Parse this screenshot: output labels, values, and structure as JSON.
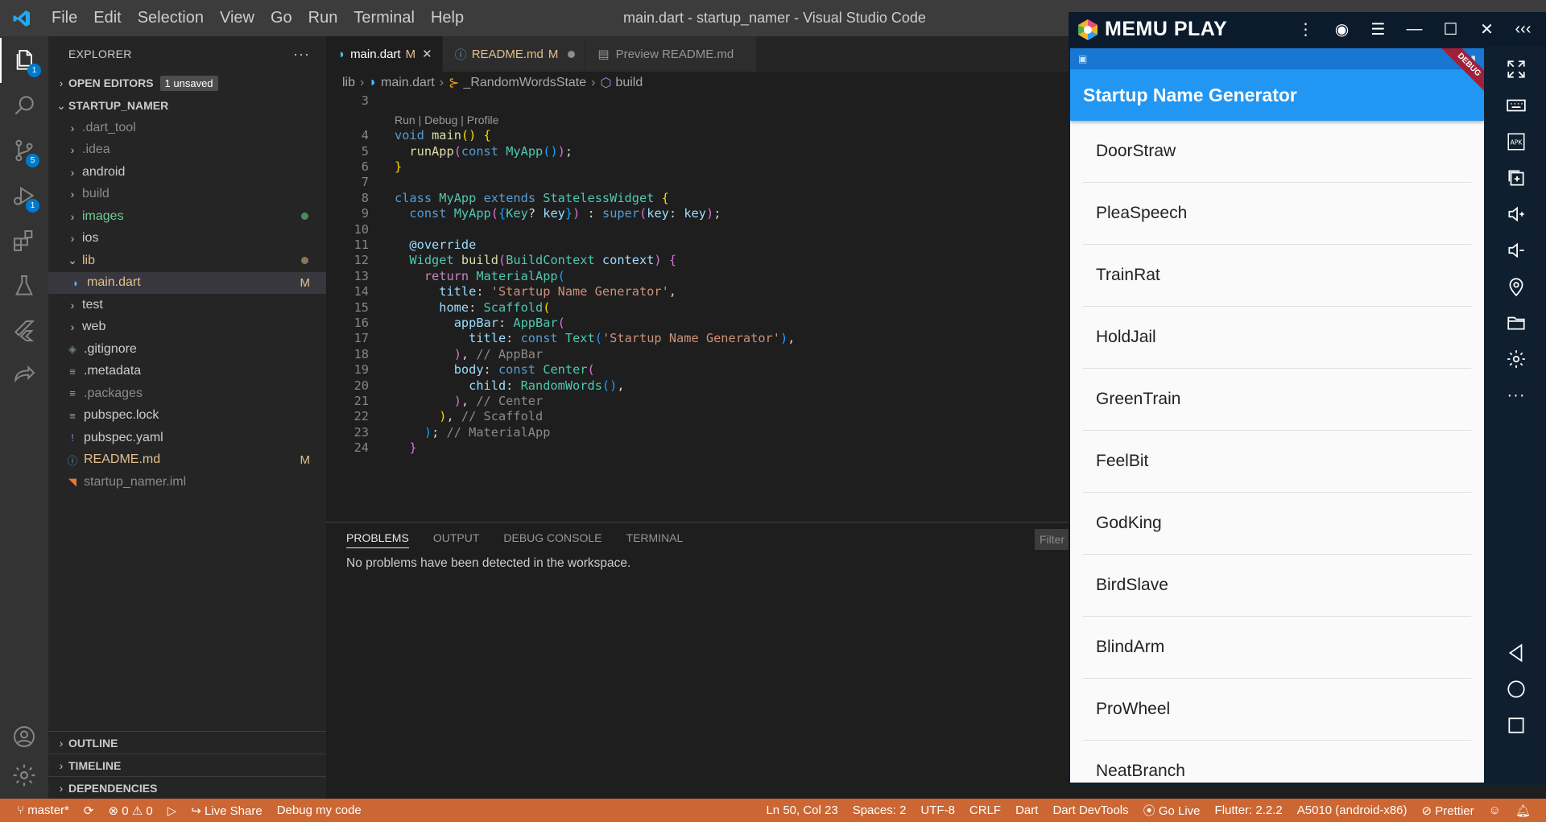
{
  "titlebar": {
    "menu": [
      "File",
      "Edit",
      "Selection",
      "View",
      "Go",
      "Run",
      "Terminal",
      "Help"
    ],
    "title": "main.dart - startup_namer - Visual Studio Code"
  },
  "activitybar": {
    "explorer_badge": "1",
    "scm_badge": "5",
    "debug_badge": "1"
  },
  "sidebar": {
    "header": "EXPLORER",
    "open_editors": "OPEN EDITORS",
    "unsaved": "1 unsaved",
    "project": "STARTUP_NAMER",
    "tree": [
      {
        "label": ".dart_tool",
        "type": "folder",
        "dim": true
      },
      {
        "label": ".idea",
        "type": "folder",
        "dim": true
      },
      {
        "label": "android",
        "type": "folder"
      },
      {
        "label": "build",
        "type": "folder",
        "dim": true
      },
      {
        "label": "images",
        "type": "folder",
        "green": true
      },
      {
        "label": "ios",
        "type": "folder"
      },
      {
        "label": "lib",
        "type": "folder-open",
        "yellow": true
      },
      {
        "label": "main.dart",
        "type": "file",
        "decoration": "M"
      },
      {
        "label": "test",
        "type": "folder"
      },
      {
        "label": "web",
        "type": "folder"
      },
      {
        "label": ".gitignore",
        "type": "file"
      },
      {
        "label": ".metadata",
        "type": "file"
      },
      {
        "label": ".packages",
        "type": "file",
        "dim": true
      },
      {
        "label": "pubspec.lock",
        "type": "file"
      },
      {
        "label": "pubspec.yaml",
        "type": "file"
      },
      {
        "label": "README.md",
        "type": "file",
        "decoration": "M"
      },
      {
        "label": "startup_namer.iml",
        "type": "file",
        "dim": true
      }
    ],
    "outline": "OUTLINE",
    "timeline": "TIMELINE",
    "dependencies": "DEPENDENCIES"
  },
  "tabs": [
    {
      "label": "main.dart",
      "mod": "M",
      "active": true
    },
    {
      "label": "README.md",
      "mod": "M",
      "active": false
    },
    {
      "label": "Preview README.md",
      "mod": "",
      "active": false
    }
  ],
  "breadcrumb": [
    "lib",
    "main.dart",
    "_RandomWordsState",
    "build"
  ],
  "code": {
    "codelens": "Run | Debug | Profile",
    "line_numbers": [
      "3",
      "4",
      "5",
      "6",
      "7",
      "8",
      "9",
      "10",
      "11",
      "12",
      "13",
      "14",
      "15",
      "16",
      "17",
      "18",
      "19",
      "20",
      "21",
      "22",
      "23",
      "24"
    ]
  },
  "panel": {
    "tabs": [
      "PROBLEMS",
      "OUTPUT",
      "DEBUG CONSOLE",
      "TERMINAL"
    ],
    "filter": "Filter",
    "message": "No problems have been detected in the workspace."
  },
  "statusbar": {
    "branch": "master*",
    "errors": "0",
    "warnings": "0",
    "live_share": "Live Share",
    "debug": "Debug my code",
    "position": "Ln 50, Col 23",
    "spaces": "Spaces: 2",
    "encoding": "UTF-8",
    "eol": "CRLF",
    "language": "Dart",
    "devtools": "Dart DevTools",
    "go_live": "Go Live",
    "flutter": "Flutter: 2.2.2",
    "device": "A5010 (android-x86)",
    "prettier": "Prettier"
  },
  "memu": {
    "brand": "MEMU PLAY",
    "app_title": "Startup Name Generator",
    "debug_banner": "DEBUG",
    "words": [
      "DoorStraw",
      "PleaSpeech",
      "TrainRat",
      "HoldJail",
      "GreenTrain",
      "FeelBit",
      "GodKing",
      "BirdSlave",
      "BlindArm",
      "ProWheel",
      "NeatBranch"
    ]
  },
  "colors": {
    "statusbar": "#cc6633",
    "appbar": "#2196f3",
    "accent": "#007acc"
  }
}
